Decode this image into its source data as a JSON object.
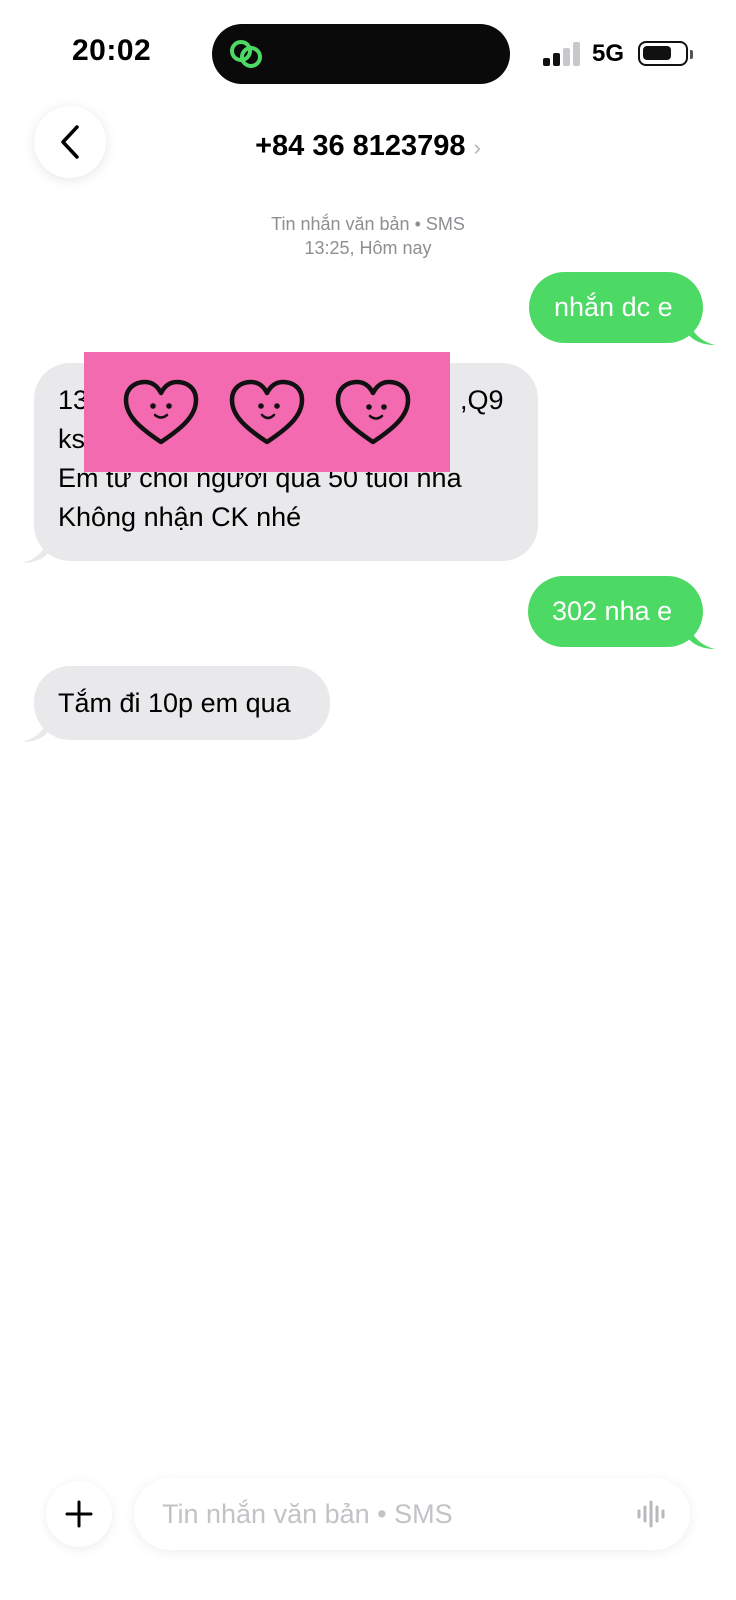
{
  "status_bar": {
    "time": "20:02",
    "network": "5G",
    "island_icon": "link-rings-icon",
    "signal_icon": "signal-bars-icon",
    "battery_icon": "battery-icon",
    "accent": "#4cd964"
  },
  "header": {
    "back_icon": "chevron-left-icon",
    "contact": "+84 36 8123798",
    "chevron": "›"
  },
  "thread_meta": {
    "type": "Tin nhắn văn bản • SMS",
    "time": "13:25, Hôm nay"
  },
  "messages": [
    {
      "direction": "outgoing",
      "lines": [
        "nhắn dc e"
      ]
    },
    {
      "direction": "incoming",
      "lines": [
        "13",
        ",Q9",
        "ks",
        "Em từ chối người quá 50 tuổi nha",
        "Không nhận CK nhé"
      ]
    },
    {
      "direction": "outgoing",
      "lines": [
        "302 nha e"
      ]
    },
    {
      "direction": "incoming",
      "lines": [
        "Tắm đi 10p em qua"
      ]
    }
  ],
  "sticker": {
    "icon": "smiling-heart-icon",
    "background": "#f46ab1"
  },
  "composer": {
    "add_icon": "plus-icon",
    "placeholder": "Tin nhắn văn bản • SMS",
    "value": "",
    "mic_icon": "audio-waveform-icon"
  },
  "colors": {
    "outgoing_bubble": "#4cd964",
    "incoming_bubble": "#e9e9eb",
    "meta_text": "#8e8e93"
  }
}
